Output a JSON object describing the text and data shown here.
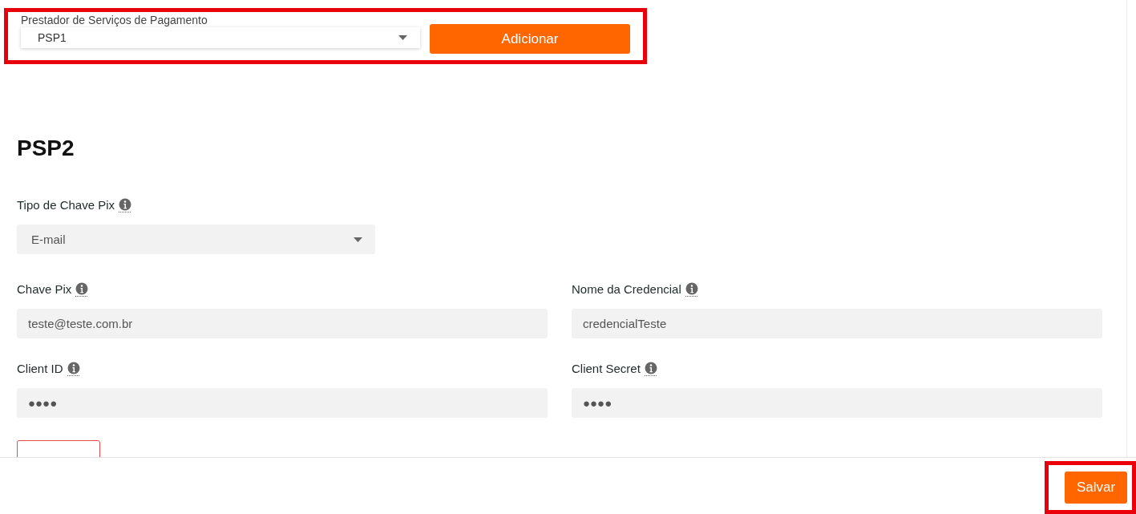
{
  "provider_selector": {
    "label": "Prestador de Serviços de Pagamento",
    "value": "PSP1",
    "button": "Adicionar",
    "highlighted": true
  },
  "section": {
    "title": "PSP2",
    "key_type": {
      "label": "Tipo de Chave Pix",
      "value": "E-mail"
    },
    "fields": [
      {
        "label": "Chave Pix",
        "value": "teste@teste.com.br"
      },
      {
        "label": "Nome da Credencial",
        "value": "credencialTeste"
      },
      {
        "label": "Client ID",
        "value": "●●●●"
      },
      {
        "label": "Client Secret",
        "value": "●●●●"
      }
    ]
  },
  "footer": {
    "save_button": "Salvar",
    "highlighted": true
  }
}
